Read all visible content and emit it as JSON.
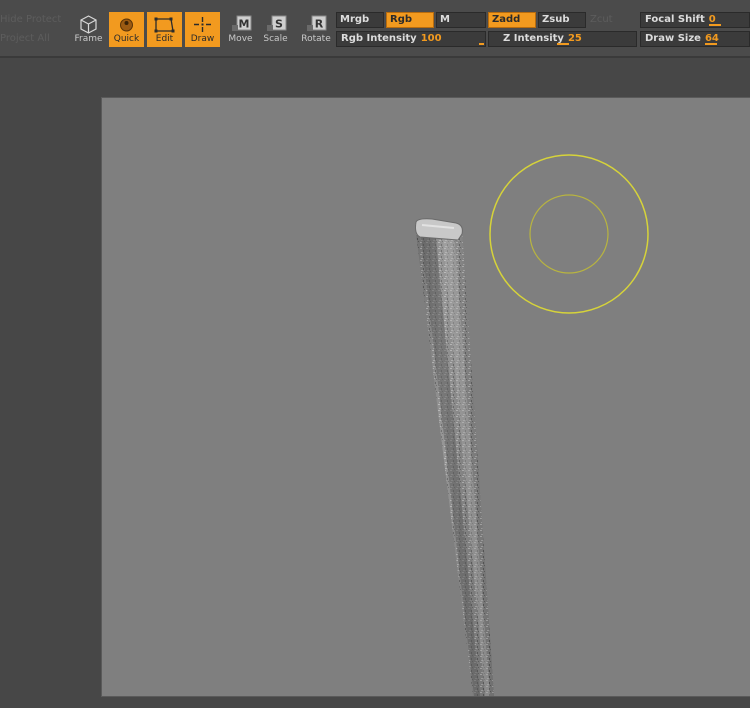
{
  "toolbar": {
    "ghost_top": "Hide   Protect",
    "ghost_bottom": "Project  All",
    "tools": [
      {
        "id": "frame",
        "label": "Frame",
        "active": false,
        "icon": "cube-frame-icon"
      },
      {
        "id": "quick",
        "label": "Quick",
        "active": true,
        "icon": "quick-sketch-icon"
      },
      {
        "id": "edit",
        "label": "Edit",
        "active": true,
        "icon": "edit-box-icon"
      },
      {
        "id": "draw",
        "label": "Draw",
        "active": true,
        "icon": "draw-crosshair-icon"
      },
      {
        "id": "move",
        "label": "Move",
        "active": false,
        "icon": "move-m-icon",
        "letter": "M"
      },
      {
        "id": "scale",
        "label": "Scale",
        "active": false,
        "icon": "scale-s-icon",
        "letter": "S"
      },
      {
        "id": "rotate",
        "label": "Rotate",
        "active": false,
        "icon": "rotate-r-icon",
        "letter": "R"
      }
    ],
    "modes": {
      "mrgb": "Mrgb",
      "rgb": "Rgb",
      "m": "M",
      "zadd": "Zadd",
      "zsub": "Zsub",
      "zcut_ghost": "Zcut"
    },
    "sliders": {
      "rgb_intensity": {
        "label": "Rgb Intensity",
        "value": "100"
      },
      "z_intensity": {
        "label": "Z Intensity",
        "value": "25"
      },
      "focal_shift": {
        "label": "Focal Shift",
        "value": "0"
      },
      "draw_size": {
        "label": "Draw Size",
        "value": "64"
      }
    },
    "accent_color": "#f29a1f"
  },
  "viewport": {
    "background": "#7f7f7f",
    "brush_color": "#d6d33a"
  }
}
